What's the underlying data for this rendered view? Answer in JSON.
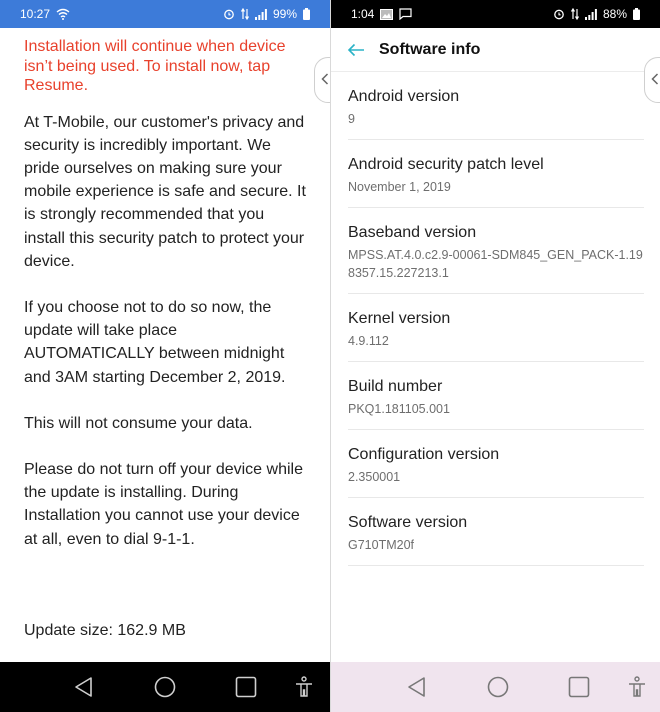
{
  "left_screen": {
    "status_bar": {
      "time": "10:27",
      "battery": "99%",
      "icons": [
        "wifi-icon",
        "alarm-icon",
        "data-arrows-icon",
        "signal-icon",
        "battery-icon"
      ]
    },
    "warning_text": "Installation will continue when device isn’t being used. To install now, tap Resume.",
    "paragraphs": [
      "At T-Mobile, our customer's privacy and security is incredibly important. We pride ourselves on making sure your mobile experience is safe and secure. It is strongly recommended that you install this security patch to protect your device.",
      "If you choose not to do so now, the update will take place AUTOMATICALLY between midnight and 3AM starting December 2, 2019.",
      "This will not consume your data.",
      "Please do not turn off your device while the update is installing. During Installation you cannot use your device at all, even to dial 9-1-1."
    ],
    "update_size": "Update size: 162.9 MB",
    "colors": {
      "status_bar": "#3d7bd9",
      "warning": "#e8412c",
      "nav_bar": "#000000"
    }
  },
  "right_screen": {
    "status_bar": {
      "time": "1:04",
      "battery": "88%",
      "icons": [
        "gallery-notification-icon",
        "message-notification-icon",
        "alarm-icon",
        "data-arrows-icon",
        "signal-icon",
        "battery-icon"
      ]
    },
    "app_bar": {
      "title": "Software info"
    },
    "items": [
      {
        "title": "Android version",
        "value": "9"
      },
      {
        "title": "Android security patch level",
        "value": "November 1, 2019"
      },
      {
        "title": "Baseband version",
        "value": "MPSS.AT.4.0.c2.9-00061-SDM845_GEN_PACK-1.198357.15.227213.1"
      },
      {
        "title": "Kernel version",
        "value": "4.9.112"
      },
      {
        "title": "Build number",
        "value": "PKQ1.181105.001"
      },
      {
        "title": "Configuration version",
        "value": "2.350001"
      },
      {
        "title": "Software version",
        "value": "G710TM20f"
      }
    ],
    "colors": {
      "accent": "#2bb3c7",
      "nav_bar": "#f0e4ee"
    }
  },
  "nav_buttons": [
    "back",
    "home",
    "recents",
    "accessibility"
  ]
}
